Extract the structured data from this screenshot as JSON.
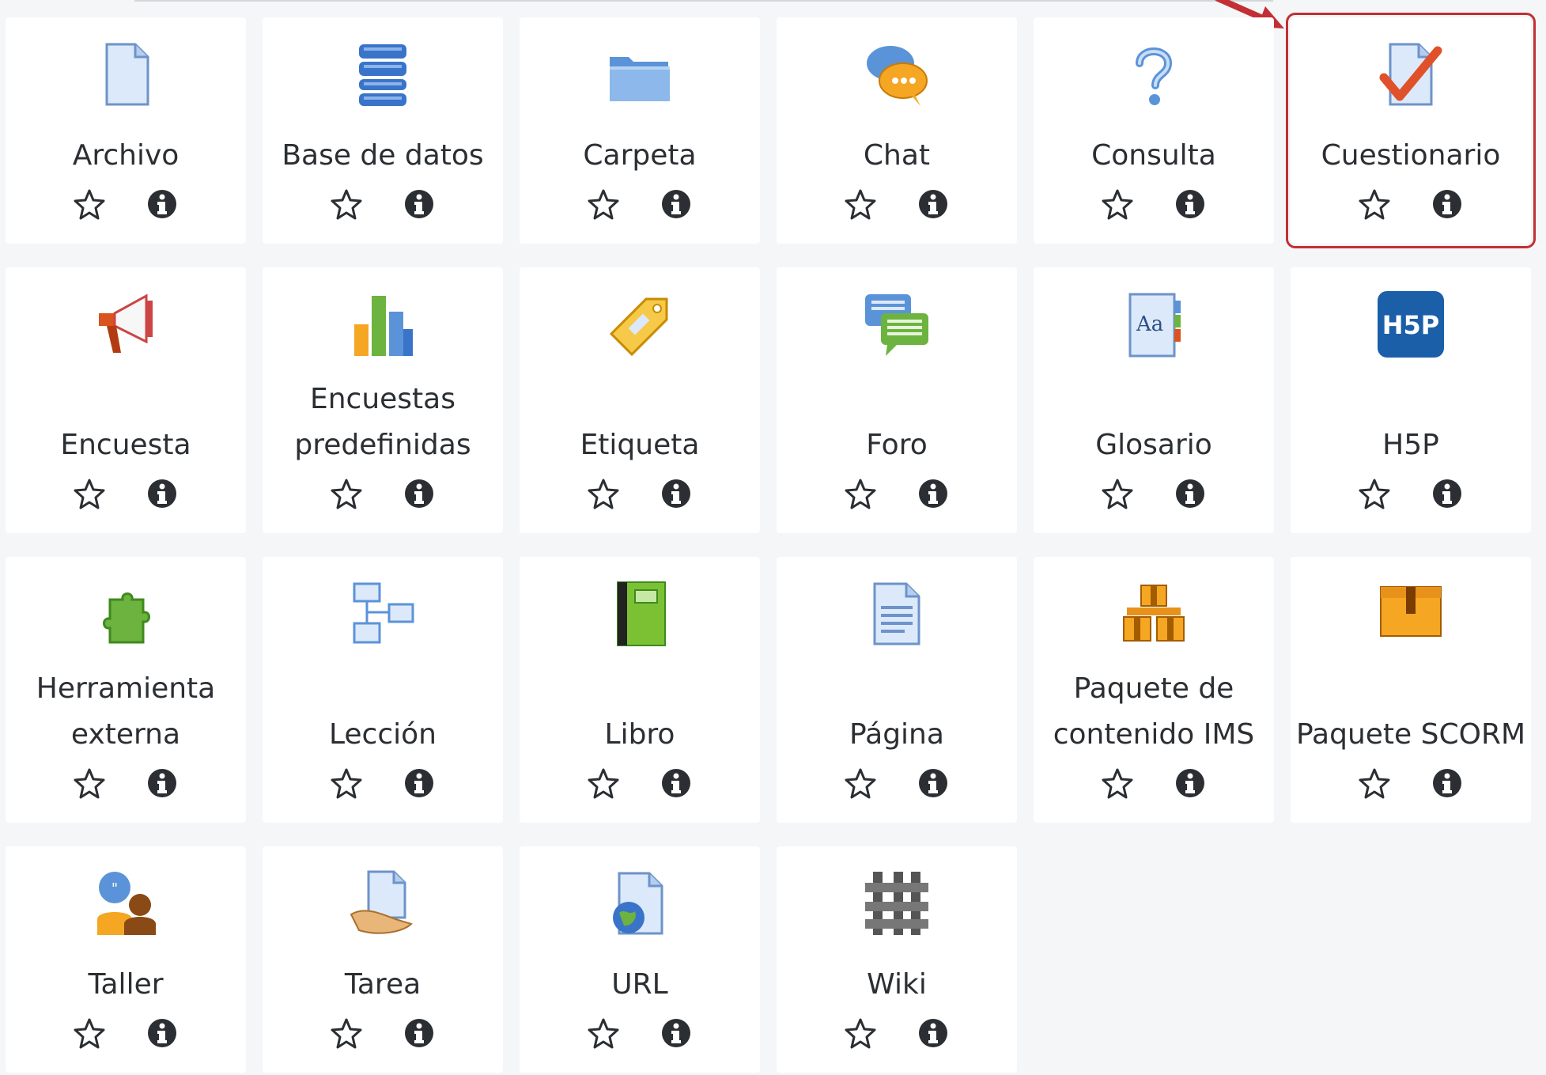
{
  "modules": [
    {
      "label": "Archivo",
      "icon": "file-icon"
    },
    {
      "label": "Base de datos",
      "icon": "database-icon"
    },
    {
      "label": "Carpeta",
      "icon": "folder-icon"
    },
    {
      "label": "Chat",
      "icon": "chat-icon"
    },
    {
      "label": "Consulta",
      "icon": "choice-icon"
    },
    {
      "label": "Cuestionario",
      "icon": "quiz-icon",
      "selected": true
    },
    {
      "label": "Encuesta",
      "icon": "megaphone-icon"
    },
    {
      "label": "Encuestas predefinidas",
      "icon": "bar-chart-icon"
    },
    {
      "label": "Etiqueta",
      "icon": "label-tag-icon"
    },
    {
      "label": "Foro",
      "icon": "forum-icon"
    },
    {
      "label": "Glosario",
      "icon": "glossary-icon"
    },
    {
      "label": "H5P",
      "icon": "h5p-icon"
    },
    {
      "label": "Herramienta externa",
      "icon": "puzzle-icon"
    },
    {
      "label": "Lección",
      "icon": "lesson-icon"
    },
    {
      "label": "Libro",
      "icon": "book-icon"
    },
    {
      "label": "Página",
      "icon": "page-icon"
    },
    {
      "label": "Paquete de contenido IMS",
      "icon": "ims-package-icon"
    },
    {
      "label": "Paquete SCORM",
      "icon": "scorm-package-icon"
    },
    {
      "label": "Taller",
      "icon": "workshop-icon"
    },
    {
      "label": "Tarea",
      "icon": "assignment-icon"
    },
    {
      "label": "URL",
      "icon": "url-icon"
    },
    {
      "label": "Wiki",
      "icon": "wiki-icon"
    }
  ],
  "colors": {
    "selection_outline": "#c22f34",
    "tile_background": "#ffffff",
    "page_background": "#f5f6f8",
    "text": "#2b2f33"
  }
}
